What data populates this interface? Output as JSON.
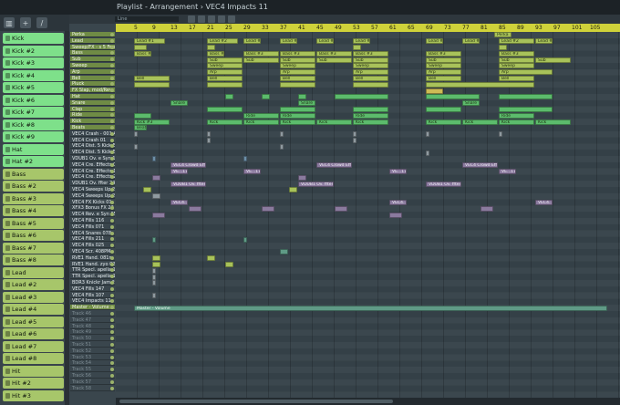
{
  "window": {
    "title": "Playlist - Arrangement  ›  VEC4 Impacts 11"
  },
  "toolbar": {
    "snap": "Line"
  },
  "ruler": {
    "bars": [
      "5",
      "9",
      "13",
      "17",
      "21",
      "25",
      "29",
      "33",
      "37",
      "41",
      "45",
      "49",
      "53",
      "57",
      "61",
      "65",
      "69",
      "73",
      "77",
      "81",
      "85",
      "89",
      "93",
      "97",
      "101",
      "105"
    ]
  },
  "channels": [
    {
      "label": "Kick",
      "color": "green"
    },
    {
      "label": "Kick #2",
      "color": "green"
    },
    {
      "label": "Kick #3",
      "color": "green"
    },
    {
      "label": "Kick #4",
      "color": "green"
    },
    {
      "label": "Kick #5",
      "color": "green"
    },
    {
      "label": "Kick #6",
      "color": "green"
    },
    {
      "label": "Kick #7",
      "color": "green"
    },
    {
      "label": "Kick #8",
      "color": "green"
    },
    {
      "label": "Kick #9",
      "color": "green"
    },
    {
      "label": "Hat",
      "color": "green"
    },
    {
      "label": "Hat #2",
      "color": "green"
    },
    {
      "label": "Bass",
      "color": "olive"
    },
    {
      "label": "Bass #2",
      "color": "olive"
    },
    {
      "label": "Bass #3",
      "color": "olive"
    },
    {
      "label": "Bass #4",
      "color": "olive"
    },
    {
      "label": "Bass #5",
      "color": "olive"
    },
    {
      "label": "Bass #6",
      "color": "olive"
    },
    {
      "label": "Bass #7",
      "color": "olive"
    },
    {
      "label": "Bass #8",
      "color": "olive"
    },
    {
      "label": "Lead",
      "color": "olive"
    },
    {
      "label": "Lead #2",
      "color": "olive"
    },
    {
      "label": "Lead #3",
      "color": "olive"
    },
    {
      "label": "Lead #4",
      "color": "olive"
    },
    {
      "label": "Lead #5",
      "color": "olive"
    },
    {
      "label": "Lead #6",
      "color": "olive"
    },
    {
      "label": "Lead #7",
      "color": "olive"
    },
    {
      "label": "Lead #8",
      "color": "olive"
    },
    {
      "label": "Hit",
      "color": "olive"
    },
    {
      "label": "Hit #2",
      "color": "olive"
    },
    {
      "label": "Hit #3",
      "color": "olive"
    }
  ],
  "tracks": [
    {
      "name": "Perka",
      "hl": true
    },
    {
      "name": "Lead",
      "hl": true
    },
    {
      "name": "Sweep/FX - s 5 Freq",
      "hl": true
    },
    {
      "name": "Bass",
      "hl": true
    },
    {
      "name": "Sub",
      "hl": true
    },
    {
      "name": "Sweep",
      "hl": true
    },
    {
      "name": "Arp",
      "hl": true
    },
    {
      "name": "Bell",
      "hl": true
    },
    {
      "name": "Pluck",
      "hl": true
    },
    {
      "name": "FX Slap, mod/Rev",
      "hl": true
    },
    {
      "name": "Hat",
      "hl": true
    },
    {
      "name": "Snare",
      "hl": true
    },
    {
      "name": "Clap",
      "hl": true
    },
    {
      "name": "Ride",
      "hl": true
    },
    {
      "name": "Kick",
      "hl": true
    },
    {
      "name": "Beats",
      "hl": true
    },
    {
      "name": "VEC4 Crash - 001 A3"
    },
    {
      "name": "VEC4 Crash 01"
    },
    {
      "name": "VEC4 Dist. 5 Kick E1"
    },
    {
      "name": "VEC4 Dist. 5 Kick E3"
    },
    {
      "name": "VDUB1 Ov. e Syn 15"
    },
    {
      "name": "VEC4 Cre. Effects 05"
    },
    {
      "name": "VEC4 Cre. Effects 17"
    },
    {
      "name": "VEC4 Cre. Effects 22"
    },
    {
      "name": "VDUB1 Ov. ffter 24"
    },
    {
      "name": "VEC4 Sweeps Up 22"
    },
    {
      "name": "VEC4 Sweeps Up 25"
    },
    {
      "name": "VEC4 FX Kicks 01"
    },
    {
      "name": "XFX3 Bonus FX 22"
    },
    {
      "name": "VEC4 Rev. e Syn 05"
    },
    {
      "name": "VEC4 Fills 116"
    },
    {
      "name": "VEC4 Fills 071"
    },
    {
      "name": "VEC4 Snares 078"
    },
    {
      "name": "VEC4 Fills 211"
    },
    {
      "name": "VEC4 Fills 025"
    },
    {
      "name": "VEC4 Scr. 408PM"
    },
    {
      "name": "RVE1 Hand. 081m 0"
    },
    {
      "name": "RVE1 Hand. zyo 021"
    },
    {
      "name": "TTR Specl. apella 14"
    },
    {
      "name": "TTR Specl. apella 15"
    },
    {
      "name": "BDR3 Knickr Jam 26"
    },
    {
      "name": "VEC4 Fills 147"
    },
    {
      "name": "VEC4 Fills 107"
    },
    {
      "name": "VEC4 Impacts 11"
    },
    {
      "name": "Master - Volume",
      "hl": true
    },
    {
      "name": "Track 46",
      "blank": true
    },
    {
      "name": "Track 47",
      "blank": true
    },
    {
      "name": "Track 48",
      "blank": true
    },
    {
      "name": "Track 49",
      "blank": true
    },
    {
      "name": "Track 50",
      "blank": true
    },
    {
      "name": "Track 51",
      "blank": true
    },
    {
      "name": "Track 52",
      "blank": true
    },
    {
      "name": "Track 53",
      "blank": true
    },
    {
      "name": "Track 54",
      "blank": true
    },
    {
      "name": "Track 55",
      "blank": true
    },
    {
      "name": "Track 56",
      "blank": true
    },
    {
      "name": "Track 57",
      "blank": true
    },
    {
      "name": "Track 58",
      "blank": true
    }
  ],
  "clips": [
    {
      "row": 0,
      "s": 84,
      "e": 88,
      "c": "olive",
      "t": "Perka"
    },
    {
      "row": 1,
      "s": 5,
      "e": 12,
      "c": "olive",
      "t": "Lead #1"
    },
    {
      "row": 1,
      "s": 21,
      "e": 28,
      "c": "olive",
      "t": "Lead #2"
    },
    {
      "row": 1,
      "s": 29,
      "e": 33,
      "c": "olive",
      "t": "Lead #2"
    },
    {
      "row": 1,
      "s": 37,
      "e": 41,
      "c": "olive",
      "t": "Lead #2"
    },
    {
      "row": 1,
      "s": 45,
      "e": 49,
      "c": "olive",
      "t": "Lead #2"
    },
    {
      "row": 1,
      "s": 53,
      "e": 57,
      "c": "olive",
      "t": "Lead #2"
    },
    {
      "row": 1,
      "s": 69,
      "e": 73,
      "c": "olive",
      "t": "Lead #2"
    },
    {
      "row": 1,
      "s": 77,
      "e": 81,
      "c": "olive",
      "t": "Lead #2"
    },
    {
      "row": 1,
      "s": 85,
      "e": 93,
      "c": "olive",
      "t": "Lead #2"
    },
    {
      "row": 1,
      "s": 93,
      "e": 97,
      "c": "olive",
      "t": "Lead #2"
    },
    {
      "row": 2,
      "s": 5,
      "e": 8,
      "c": "olive",
      "t": ""
    },
    {
      "row": 2,
      "s": 21,
      "e": 23,
      "c": "olive",
      "t": ""
    },
    {
      "row": 2,
      "s": 53,
      "e": 55,
      "c": "olive",
      "t": ""
    },
    {
      "row": 2,
      "s": 85,
      "e": 87,
      "c": "olive",
      "t": ""
    },
    {
      "row": 3,
      "s": 5,
      "e": 9,
      "c": "olive",
      "t": "Bass #1"
    },
    {
      "row": 3,
      "s": 21,
      "e": 25,
      "c": "olive",
      "t": "Bass #2"
    },
    {
      "row": 3,
      "s": 29,
      "e": 37,
      "c": "olive",
      "t": "Bass #3"
    },
    {
      "row": 3,
      "s": 37,
      "e": 45,
      "c": "olive",
      "t": "Bass #3"
    },
    {
      "row": 3,
      "s": 45,
      "e": 53,
      "c": "olive",
      "t": "Bass #3"
    },
    {
      "row": 3,
      "s": 53,
      "e": 61,
      "c": "olive",
      "t": "Bass #3"
    },
    {
      "row": 3,
      "s": 69,
      "e": 77,
      "c": "olive",
      "t": "Bass #3"
    },
    {
      "row": 3,
      "s": 85,
      "e": 93,
      "c": "olive",
      "t": "Bass #3"
    },
    {
      "row": 4,
      "s": 21,
      "e": 29,
      "c": "olive",
      "t": "Sub"
    },
    {
      "row": 4,
      "s": 29,
      "e": 37,
      "c": "olive",
      "t": "Sub"
    },
    {
      "row": 4,
      "s": 37,
      "e": 45,
      "c": "olive",
      "t": "Sub"
    },
    {
      "row": 4,
      "s": 45,
      "e": 53,
      "c": "olive",
      "t": "Sub"
    },
    {
      "row": 4,
      "s": 53,
      "e": 61,
      "c": "olive",
      "t": "Sub"
    },
    {
      "row": 4,
      "s": 69,
      "e": 77,
      "c": "olive",
      "t": "Sub"
    },
    {
      "row": 4,
      "s": 85,
      "e": 93,
      "c": "olive",
      "t": "Sub"
    },
    {
      "row": 4,
      "s": 93,
      "e": 101,
      "c": "olive",
      "t": "Sub"
    },
    {
      "row": 5,
      "s": 21,
      "e": 29,
      "c": "olive",
      "t": "Sweep"
    },
    {
      "row": 5,
      "s": 37,
      "e": 45,
      "c": "olive",
      "t": "Sweep"
    },
    {
      "row": 5,
      "s": 53,
      "e": 61,
      "c": "olive",
      "t": "Sweep"
    },
    {
      "row": 5,
      "s": 69,
      "e": 77,
      "c": "olive",
      "t": "Sweep"
    },
    {
      "row": 5,
      "s": 85,
      "e": 93,
      "c": "olive",
      "t": "Sweep"
    },
    {
      "row": 6,
      "s": 21,
      "e": 29,
      "c": "olive",
      "t": "Arp"
    },
    {
      "row": 6,
      "s": 37,
      "e": 45,
      "c": "olive",
      "t": "Arp"
    },
    {
      "row": 6,
      "s": 53,
      "e": 61,
      "c": "olive",
      "t": "Arp"
    },
    {
      "row": 6,
      "s": 69,
      "e": 77,
      "c": "olive",
      "t": "Arp"
    },
    {
      "row": 6,
      "s": 85,
      "e": 97,
      "c": "olive",
      "t": "Arp"
    },
    {
      "row": 7,
      "s": 5,
      "e": 13,
      "c": "olive",
      "t": "Bell"
    },
    {
      "row": 7,
      "s": 21,
      "e": 29,
      "c": "olive",
      "t": "Bell"
    },
    {
      "row": 7,
      "s": 37,
      "e": 45,
      "c": "olive",
      "t": "Bell"
    },
    {
      "row": 7,
      "s": 53,
      "e": 61,
      "c": "olive",
      "t": "Bell"
    },
    {
      "row": 7,
      "s": 69,
      "e": 77,
      "c": "olive",
      "t": "Bell"
    },
    {
      "row": 7,
      "s": 85,
      "e": 93,
      "c": "olive",
      "t": "Bell"
    },
    {
      "row": 8,
      "s": 5,
      "e": 13,
      "c": "olive",
      "t": ""
    },
    {
      "row": 8,
      "s": 21,
      "e": 29,
      "c": "olive",
      "t": ""
    },
    {
      "row": 8,
      "s": 37,
      "e": 45,
      "c": "olive",
      "t": ""
    },
    {
      "row": 8,
      "s": 53,
      "e": 61,
      "c": "olive",
      "t": ""
    },
    {
      "row": 8,
      "s": 69,
      "e": 93,
      "c": "olive",
      "t": ""
    },
    {
      "row": 9,
      "s": 69,
      "e": 73,
      "c": "yellow",
      "t": ""
    },
    {
      "row": 10,
      "s": 25,
      "e": 27,
      "c": "green",
      "t": ""
    },
    {
      "row": 10,
      "s": 33,
      "e": 35,
      "c": "green",
      "t": ""
    },
    {
      "row": 10,
      "s": 41,
      "e": 43,
      "c": "green",
      "t": ""
    },
    {
      "row": 10,
      "s": 49,
      "e": 61,
      "c": "green",
      "t": ""
    },
    {
      "row": 10,
      "s": 69,
      "e": 81,
      "c": "green",
      "t": ""
    },
    {
      "row": 10,
      "s": 85,
      "e": 97,
      "c": "green",
      "t": ""
    },
    {
      "row": 11,
      "s": 13,
      "e": 17,
      "c": "green",
      "t": "Snare"
    },
    {
      "row": 11,
      "s": 41,
      "e": 45,
      "c": "green",
      "t": "Snare"
    },
    {
      "row": 11,
      "s": 77,
      "e": 81,
      "c": "green",
      "t": "Snare"
    },
    {
      "row": 12,
      "s": 21,
      "e": 29,
      "c": "green",
      "t": ""
    },
    {
      "row": 12,
      "s": 37,
      "e": 45,
      "c": "green",
      "t": ""
    },
    {
      "row": 12,
      "s": 53,
      "e": 61,
      "c": "green",
      "t": ""
    },
    {
      "row": 12,
      "s": 69,
      "e": 77,
      "c": "green",
      "t": ""
    },
    {
      "row": 12,
      "s": 85,
      "e": 97,
      "c": "green",
      "t": ""
    },
    {
      "row": 13,
      "s": 5,
      "e": 9,
      "c": "green",
      "t": ""
    },
    {
      "row": 13,
      "s": 29,
      "e": 37,
      "c": "green",
      "t": "Ride"
    },
    {
      "row": 13,
      "s": 37,
      "e": 45,
      "c": "green",
      "t": "Ride"
    },
    {
      "row": 13,
      "s": 53,
      "e": 61,
      "c": "green",
      "t": "Ride"
    },
    {
      "row": 13,
      "s": 85,
      "e": 93,
      "c": "green",
      "t": "Ride"
    },
    {
      "row": 14,
      "s": 5,
      "e": 13,
      "c": "green",
      "t": "Kick #3"
    },
    {
      "row": 14,
      "s": 21,
      "e": 29,
      "c": "green",
      "t": "Kick"
    },
    {
      "row": 14,
      "s": 29,
      "e": 37,
      "c": "green",
      "t": "Kick"
    },
    {
      "row": 14,
      "s": 37,
      "e": 45,
      "c": "green",
      "t": "Kick"
    },
    {
      "row": 14,
      "s": 45,
      "e": 53,
      "c": "green",
      "t": "Kick"
    },
    {
      "row": 14,
      "s": 53,
      "e": 61,
      "c": "green",
      "t": "Kick"
    },
    {
      "row": 14,
      "s": 69,
      "e": 77,
      "c": "green",
      "t": "Kick"
    },
    {
      "row": 14,
      "s": 77,
      "e": 85,
      "c": "green",
      "t": "Kick"
    },
    {
      "row": 14,
      "s": 85,
      "e": 93,
      "c": "green",
      "t": "Kick"
    },
    {
      "row": 14,
      "s": 93,
      "e": 101,
      "c": "green",
      "t": "Kick"
    },
    {
      "row": 15,
      "s": 5,
      "e": 8,
      "c": "green",
      "t": "Beats"
    },
    {
      "row": 16,
      "s": 5,
      "e": 6,
      "c": "gray",
      "t": ""
    },
    {
      "row": 16,
      "s": 21,
      "e": 22,
      "c": "gray",
      "t": ""
    },
    {
      "row": 16,
      "s": 37,
      "e": 38,
      "c": "gray",
      "t": ""
    },
    {
      "row": 16,
      "s": 53,
      "e": 54,
      "c": "gray",
      "t": ""
    },
    {
      "row": 16,
      "s": 69,
      "e": 70,
      "c": "gray",
      "t": ""
    },
    {
      "row": 16,
      "s": 85,
      "e": 86,
      "c": "gray",
      "t": ""
    },
    {
      "row": 17,
      "s": 21,
      "e": 22,
      "c": "gray",
      "t": ""
    },
    {
      "row": 17,
      "s": 53,
      "e": 54,
      "c": "gray",
      "t": ""
    },
    {
      "row": 18,
      "s": 5,
      "e": 6,
      "c": "gray",
      "t": ""
    },
    {
      "row": 18,
      "s": 37,
      "e": 38,
      "c": "gray",
      "t": ""
    },
    {
      "row": 19,
      "s": 69,
      "e": 70,
      "c": "gray",
      "t": ""
    },
    {
      "row": 20,
      "s": 9,
      "e": 10,
      "c": "blue",
      "t": ""
    },
    {
      "row": 20,
      "s": 29,
      "e": 30,
      "c": "blue",
      "t": ""
    },
    {
      "row": 21,
      "s": 13,
      "e": 21,
      "c": "purple",
      "t": "VEC4 Crowd Effects 05"
    },
    {
      "row": 21,
      "s": 45,
      "e": 53,
      "c": "purple",
      "t": "VEC4 Crowd Effects 05"
    },
    {
      "row": 21,
      "s": 77,
      "e": 85,
      "c": "purple",
      "t": "VEC4 Crowd Effects 05"
    },
    {
      "row": 22,
      "s": 13,
      "e": 17,
      "c": "purple",
      "t": "VE...17"
    },
    {
      "row": 22,
      "s": 29,
      "e": 33,
      "c": "purple",
      "t": "VE...17"
    },
    {
      "row": 22,
      "s": 61,
      "e": 65,
      "c": "purple",
      "t": "VE...17"
    },
    {
      "row": 22,
      "s": 85,
      "e": 89,
      "c": "purple",
      "t": "VE...17"
    },
    {
      "row": 23,
      "s": 9,
      "e": 11,
      "c": "purple",
      "t": ""
    },
    {
      "row": 23,
      "s": 41,
      "e": 43,
      "c": "purple",
      "t": ""
    },
    {
      "row": 24,
      "s": 13,
      "e": 21,
      "c": "purple",
      "t": "VDUB1 Ov. ffter 24"
    },
    {
      "row": 24,
      "s": 41,
      "e": 49,
      "c": "purple",
      "t": "VDUB1 Ov. ffter 24"
    },
    {
      "row": 24,
      "s": 69,
      "e": 77,
      "c": "purple",
      "t": "VDUB1 Ov. ffter 24"
    },
    {
      "row": 25,
      "s": 7,
      "e": 9,
      "c": "olive",
      "t": ""
    },
    {
      "row": 25,
      "s": 39,
      "e": 41,
      "c": "olive",
      "t": ""
    },
    {
      "row": 26,
      "s": 9,
      "e": 11,
      "c": "gray",
      "t": ""
    },
    {
      "row": 27,
      "s": 13,
      "e": 17,
      "c": "purple",
      "t": "VEC4...Ks 01"
    },
    {
      "row": 27,
      "s": 61,
      "e": 65,
      "c": "purple",
      "t": "VEC4...Ks 01"
    },
    {
      "row": 27,
      "s": 93,
      "e": 97,
      "c": "purple",
      "t": "VEC4...Ks 01"
    },
    {
      "row": 28,
      "s": 17,
      "e": 20,
      "c": "purple",
      "t": ""
    },
    {
      "row": 28,
      "s": 33,
      "e": 36,
      "c": "purple",
      "t": ""
    },
    {
      "row": 28,
      "s": 49,
      "e": 52,
      "c": "purple",
      "t": ""
    },
    {
      "row": 28,
      "s": 81,
      "e": 84,
      "c": "purple",
      "t": ""
    },
    {
      "row": 29,
      "s": 9,
      "e": 12,
      "c": "purple",
      "t": ""
    },
    {
      "row": 29,
      "s": 61,
      "e": 64,
      "c": "purple",
      "t": ""
    },
    {
      "row": 33,
      "s": 9,
      "e": 10,
      "c": "teal",
      "t": ""
    },
    {
      "row": 33,
      "s": 29,
      "e": 30,
      "c": "teal",
      "t": ""
    },
    {
      "row": 35,
      "s": 37,
      "e": 39,
      "c": "teal",
      "t": ""
    },
    {
      "row": 36,
      "s": 9,
      "e": 11,
      "c": "olive",
      "t": ""
    },
    {
      "row": 36,
      "s": 21,
      "e": 23,
      "c": "olive",
      "t": ""
    },
    {
      "row": 37,
      "s": 9,
      "e": 11,
      "c": "olive",
      "t": ""
    },
    {
      "row": 37,
      "s": 25,
      "e": 27,
      "c": "olive",
      "t": ""
    },
    {
      "row": 38,
      "s": 9,
      "e": 10,
      "c": "gray",
      "t": ""
    },
    {
      "row": 39,
      "s": 9,
      "e": 10,
      "c": "gray",
      "t": ""
    },
    {
      "row": 40,
      "s": 9,
      "e": 10,
      "c": "gray",
      "t": ""
    },
    {
      "row": 42,
      "s": 9,
      "e": 10,
      "c": "gray",
      "t": ""
    },
    {
      "row": 44,
      "s": 5,
      "e": 109,
      "c": "teal",
      "t": "Master - Volume"
    }
  ]
}
